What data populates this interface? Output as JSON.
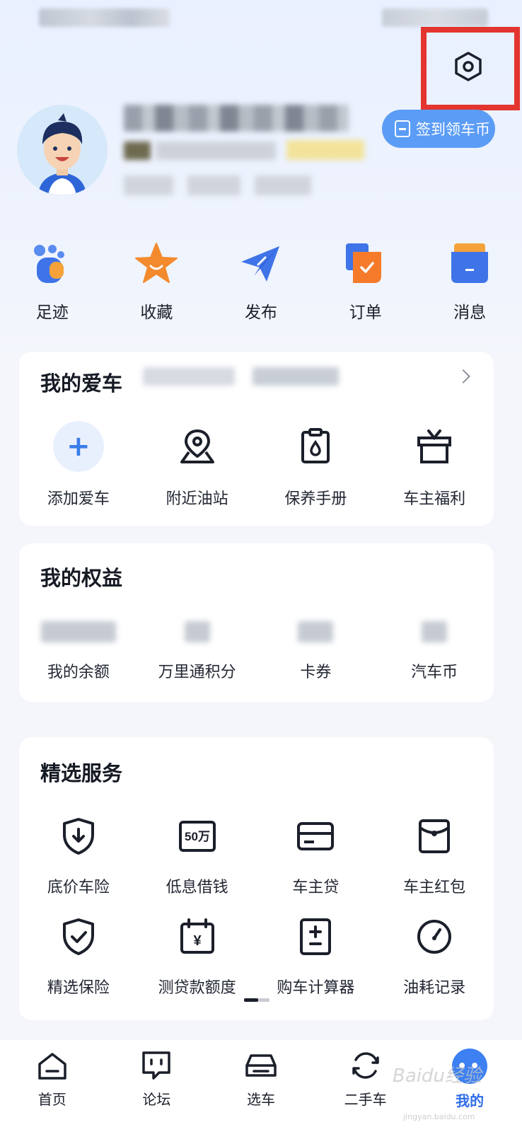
{
  "header": {
    "checkin_label": "签到领车币"
  },
  "quick_actions": [
    {
      "label": "足迹",
      "icon": "footprint-icon"
    },
    {
      "label": "收藏",
      "icon": "star-icon"
    },
    {
      "label": "发布",
      "icon": "paper-plane-icon"
    },
    {
      "label": "订单",
      "icon": "order-icon"
    },
    {
      "label": "消息",
      "icon": "message-icon"
    }
  ],
  "my_car": {
    "title": "我的爱车",
    "items": [
      {
        "label": "添加爱车",
        "icon": "plus-icon"
      },
      {
        "label": "附近油站",
        "icon": "map-pin-icon"
      },
      {
        "label": "保养手册",
        "icon": "oil-drop-icon"
      },
      {
        "label": "车主福利",
        "icon": "gift-box-icon"
      }
    ]
  },
  "benefits": {
    "title": "我的权益",
    "items": [
      {
        "label": "我的余额"
      },
      {
        "label": "万里通积分"
      },
      {
        "label": "卡券"
      },
      {
        "label": "汽车币"
      }
    ]
  },
  "services": {
    "title": "精选服务",
    "items": [
      {
        "label": "底价车险",
        "icon": "shield-download-icon"
      },
      {
        "label": "低息借钱",
        "icon": "loan-50-icon",
        "badge": "50万"
      },
      {
        "label": "车主贷",
        "icon": "card-icon"
      },
      {
        "label": "车主红包",
        "icon": "red-packet-icon"
      },
      {
        "label": "精选保险",
        "icon": "shield-check-icon"
      },
      {
        "label": "测贷款额度",
        "icon": "calendar-yuan-icon",
        "badge": "¥"
      },
      {
        "label": "购车计算器",
        "icon": "calculator-icon"
      },
      {
        "label": "油耗记录",
        "icon": "gauge-icon"
      }
    ]
  },
  "tabbar": {
    "items": [
      {
        "label": "首页",
        "icon": "home-icon"
      },
      {
        "label": "论坛",
        "icon": "forum-icon"
      },
      {
        "label": "选车",
        "icon": "car-icon"
      },
      {
        "label": "二手车",
        "icon": "refresh-icon"
      },
      {
        "label": "我的",
        "icon": "profile-icon",
        "active": true
      }
    ]
  },
  "watermark": {
    "text": "Baidu经验",
    "sub": "jingyan.baidu.com"
  },
  "colors": {
    "accent": "#3d80f2",
    "highlight_box": "#e3342f",
    "checkin_bg": "#5b9cf6"
  }
}
